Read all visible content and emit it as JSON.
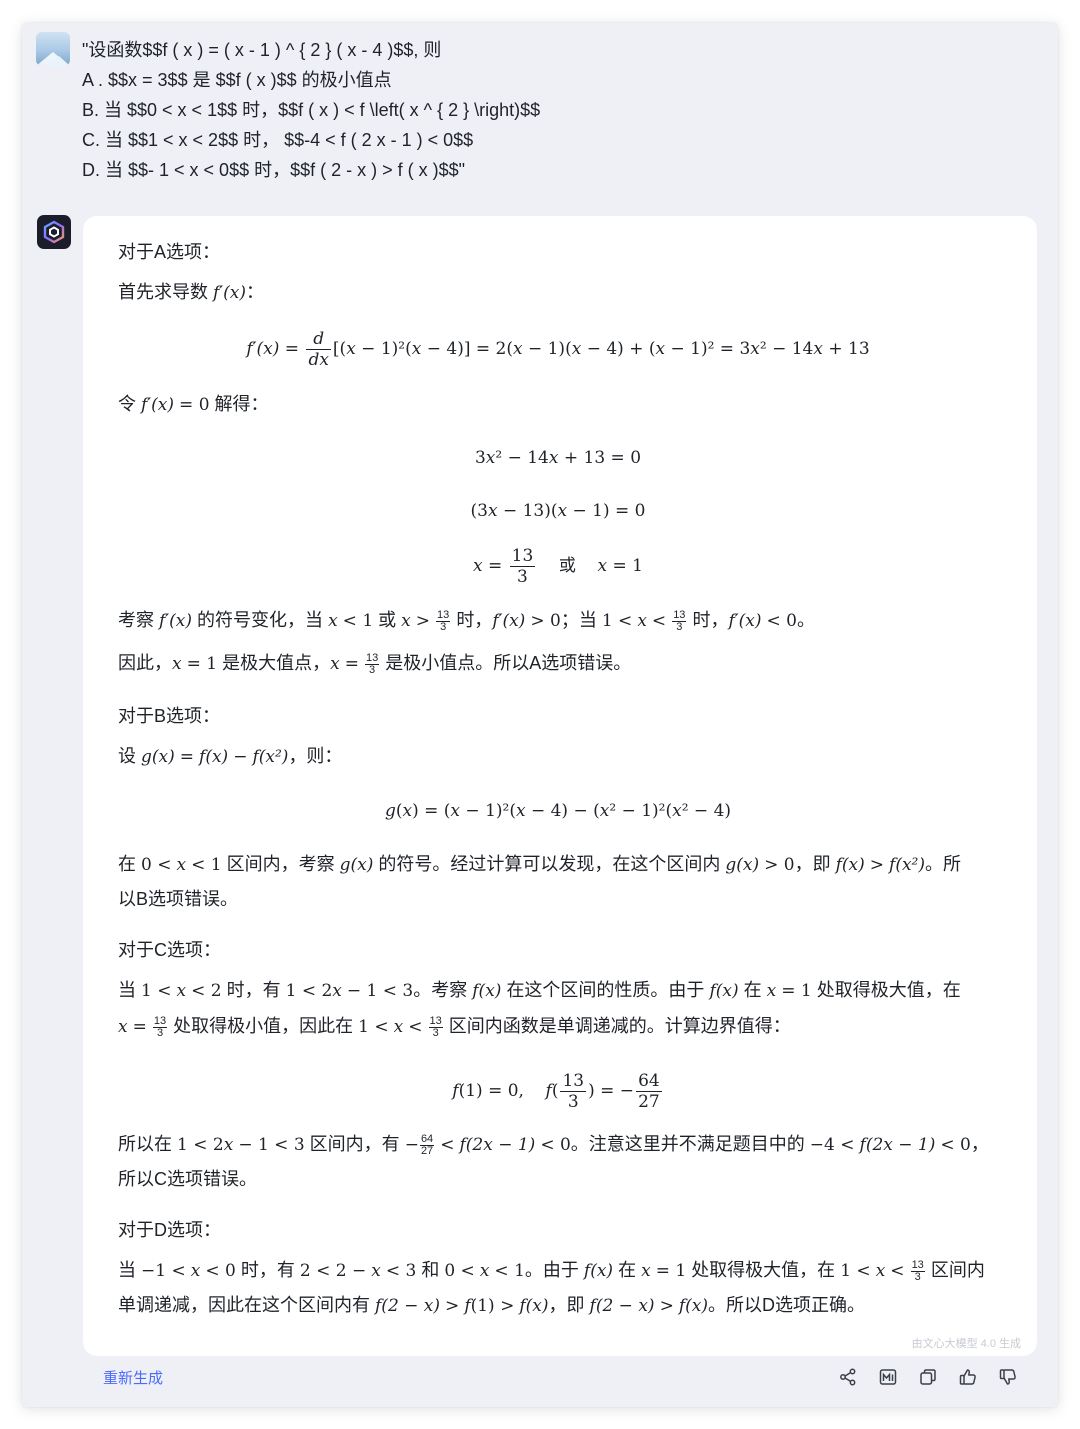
{
  "question": {
    "lines": [
      "\"设函数$$f ( x ) = ( x - 1 ) ^ { 2 } ( x - 4 )$$, 则",
      "A . $$x = 3$$ 是 $$f ( x )$$ 的极小值点",
      "B. 当 $$0 < x < 1$$ 时，$$f ( x ) < f \\left( x ^ { 2 } \\right)$$",
      "C. 当 $$1 < x < 2$$ 时， $$-4 < f ( 2 x - 1 ) < 0$$",
      "D. 当 $$- 1 < x < 0$$ 时，$$f ( 2 - x ) > f ( x )$$\""
    ]
  },
  "answer": {
    "a_title": "对于A选项：",
    "a_deriv_intro": "首先求导数",
    "a_set_zero": "解得：",
    "or_word": "或",
    "a_conclusion_1": "是极大值点，",
    "a_conclusion_2": "是极小值点。所以A选项错误。",
    "b_title": "对于B选项：",
    "b_setup_suffix": "，则：",
    "b_text_1": "区间内，考察",
    "b_text_2": "的符号。经过计算可以发现，在这个区间内",
    "b_text_3": "，即",
    "b_text_4": "。所",
    "b_text_5": "以B选项错误。",
    "c_title": "对于C选项：",
    "c_text_1": "时，有",
    "c_text_2": "。考察",
    "c_text_3": "在这个区间的性质。由于",
    "c_text_4": "处取得极大值，在",
    "c_text_5": "处取得极小值，因此在",
    "c_text_6": "区间内函数是单调递减的。计算边界值得：",
    "c_text_7": "区间内，有",
    "c_text_8": "。注意这里并不满足题目中的",
    "c_text_9": "所以C选项错误。",
    "d_title": "对于D选项：",
    "d_text_1": "时，有",
    "d_text_2": "和",
    "d_text_3": "。由于",
    "d_text_4": "在",
    "d_text_5": "处取得极大值，在",
    "d_text_6": "区间内",
    "d_text_7": "单调递减，因此在这个区间内有",
    "d_text_8": "，即",
    "d_text_9": "。所以D选项正确。",
    "kaocha": "考察",
    "fuhao": "的符号变化，当",
    "shi": "时，",
    "dang": "当",
    "zai": "在",
    "you": "有",
    "she": "设",
    "ling": "令",
    "yinci": "因此，",
    "suoyi_zai": "所以在",
    "semi": "；",
    "comma": "，"
  },
  "watermark": "由文心大模型 4.0 生成",
  "footer": {
    "regenerate_label": "重新生成"
  },
  "icons": [
    "share-icon",
    "image-icon",
    "copy-icon",
    "thumbs-up-icon",
    "thumbs-down-icon"
  ],
  "colors": {
    "accent": "#4b6bfb",
    "frame_bg": "#eef0f6",
    "bot_avatar": "#1b1d2a"
  }
}
